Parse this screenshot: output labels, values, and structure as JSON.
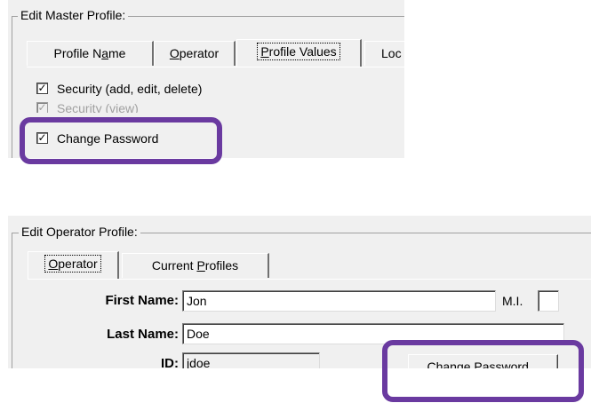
{
  "master_profile": {
    "legend": "Edit Master Profile:",
    "tabs": [
      {
        "label": "Profile Name"
      },
      {
        "label": "Operator"
      },
      {
        "label": "Profile Values",
        "active": true
      },
      {
        "label": "Loc"
      }
    ],
    "checkboxes": [
      {
        "label": "Security (add, edit, delete)",
        "checked": true,
        "enabled": true
      },
      {
        "label": "Security (view)",
        "checked": true,
        "enabled": false
      },
      {
        "label": "Change Password",
        "checked": true,
        "enabled": true,
        "highlighted": true
      }
    ]
  },
  "operator_profile": {
    "legend": "Edit Operator Profile:",
    "tabs": [
      {
        "label": "Operator",
        "active": true
      },
      {
        "label": "Current Profiles"
      }
    ],
    "fields": {
      "first_name_label": "First Name:",
      "first_name_value": "Jon",
      "mi_label": "M.I.",
      "mi_value": "",
      "last_name_label": "Last Name:",
      "last_name_value": "Doe",
      "id_label": "ID:",
      "id_value": "jdoe"
    },
    "change_password_button": "Change Password..."
  },
  "colors": {
    "highlight": "#6a3aa0",
    "window_bg": "#f0f0f0"
  },
  "icons": {
    "check": "check-mark-icon"
  }
}
